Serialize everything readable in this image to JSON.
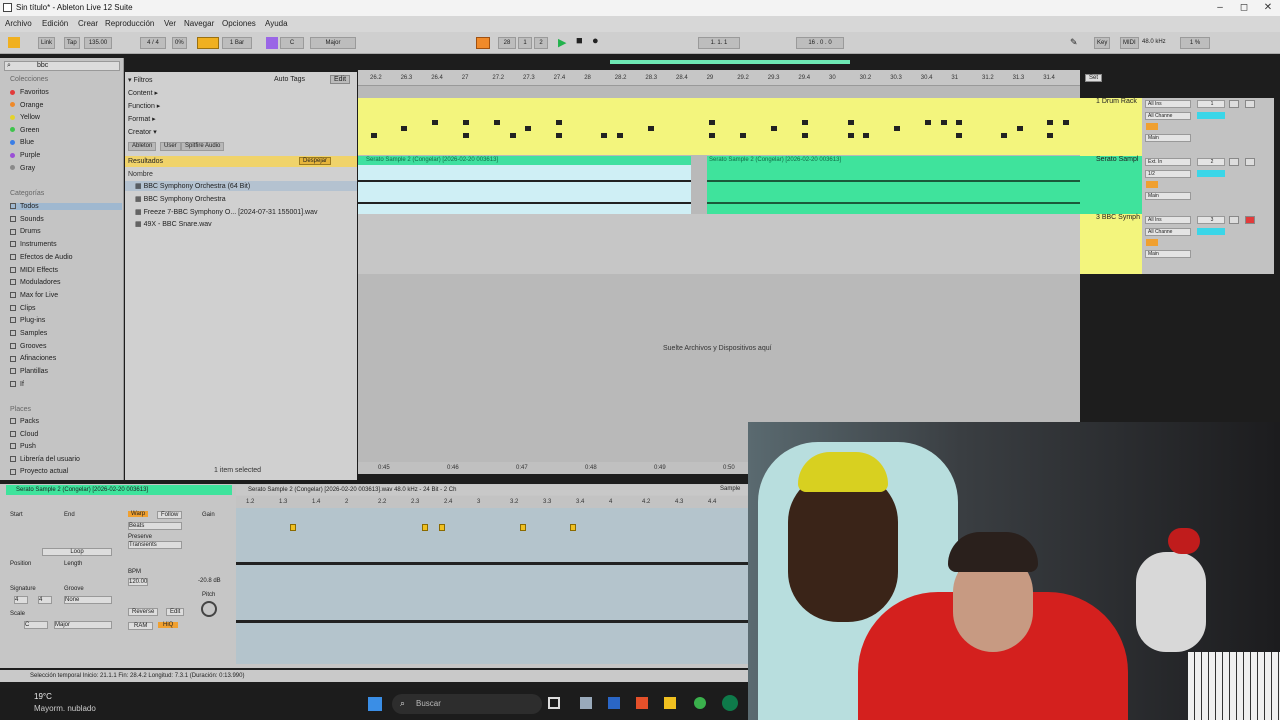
{
  "window": {
    "title": "Sin título* - Ableton Live 12 Suite",
    "minimize": "–",
    "maximize": "◻",
    "close": "✕"
  },
  "menu": [
    "Archivo",
    "Edición",
    "Crear",
    "Reproducción",
    "Ver",
    "Navegar",
    "Opciones",
    "Ayuda"
  ],
  "transport": {
    "link": "Link",
    "tap": "Tap",
    "tempo": "135.00",
    "signature": "4 / 4",
    "pct": "0%",
    "quant": "1 Bar",
    "key": "C",
    "scale": "Major",
    "pos1": "28",
    "pos2": "1",
    "pos3": "2",
    "arr_pos": "1. 1. 1",
    "punch": "16 . 0 . 0",
    "key_btn": "Key",
    "midi": "MIDI",
    "sr": "48.0 kHz",
    "cpu": "1 %"
  },
  "browser": {
    "search": "bbc",
    "collections_title": "Colecciones",
    "collections": [
      {
        "label": "Favoritos",
        "color": "#e23b3b"
      },
      {
        "label": "Orange",
        "color": "#ef8a2a"
      },
      {
        "label": "Yellow",
        "color": "#e4d32c"
      },
      {
        "label": "Green",
        "color": "#3ec44c"
      },
      {
        "label": "Blue",
        "color": "#3a7ee6"
      },
      {
        "label": "Purple",
        "color": "#9a4fd6"
      },
      {
        "label": "Gray",
        "color": "#8a8a8a"
      }
    ],
    "categories_title": "Categorías",
    "categories": [
      "Todos",
      "Sounds",
      "Drums",
      "Instruments",
      "Efectos de Audio",
      "MIDI Effects",
      "Moduladores",
      "Max for Live",
      "Clips",
      "Plug-ins",
      "Samples",
      "Grooves",
      "Afinaciones",
      "Plantillas",
      "If"
    ],
    "places_title": "Places",
    "places": [
      "Packs",
      "Cloud",
      "Push",
      "Librería del usuario",
      "Proyecto actual"
    ],
    "filters": "Filtros",
    "autotags": "Auto Tags",
    "edit": "Edit",
    "filter_items": [
      "Content ▸",
      "Function ▸",
      "Format ▸",
      "Creator ▾"
    ],
    "tags": [
      "Ableton",
      "User",
      "Spitfire Audio"
    ],
    "results": "Resultados",
    "clear": "Despejar",
    "name_col": "Nombre",
    "files": [
      "BBC Symphony Orchestra (64 Bit)",
      "BBC Symphony Orchestra",
      "Freeze 7-BBC Symphony O... [2024-07-31 155001].wav",
      "49X - BBC Snare.wav"
    ],
    "selected": "1 item selected"
  },
  "arrangement": {
    "ruler": [
      "26.2",
      "26.3",
      "26.4",
      "27",
      "27.2",
      "27.3",
      "27.4",
      "28",
      "28.2",
      "28.3",
      "28.4",
      "29",
      "29.2",
      "29.3",
      "29.4",
      "30",
      "30.2",
      "30.3",
      "30.4",
      "31",
      "31.2",
      "31.3",
      "31.4"
    ],
    "clip_a": "Serato Sample 2 (Congelar) [2026-02-20 003613]",
    "clip_b": "Serato Sample 2 (Congelar) [2026-02-20 003613]",
    "drop_hint": "Suelte Archivos y Dispositivos aquí",
    "time_ruler": [
      "0:45",
      "0:46",
      "0:47",
      "0:48",
      "0:49",
      "0:50"
    ],
    "tracks": [
      {
        "name": "1 Drum Rack",
        "num": "1",
        "input": "All Ins",
        "channel": "All Channe",
        "out": "Main"
      },
      {
        "name": "Serato Sampl",
        "num": "2",
        "input": "Ext. In",
        "channel": "1/2",
        "out": "Main"
      },
      {
        "name": "3 BBC Symph",
        "num": "3",
        "input": "All Ins",
        "channel": "All Channe",
        "out": "Main"
      }
    ],
    "set": "Set"
  },
  "detail": {
    "clip": "Serato Sample 2 (Congelar) [2026-02-20 003613]",
    "info": "Serato Sample 2 (Congelar) [2026-02-20 003613].wav 48.0 kHz - 24 Bit - 2 Ch",
    "sample": "Sample",
    "labels": {
      "start": "Start",
      "end": "End",
      "loop": "Loop",
      "position": "Position",
      "length": "Length",
      "signature": "Signature",
      "groove": "Groove",
      "scale": "Scale",
      "warp": "Warp",
      "follow": "Follow",
      "mode": "Beats",
      "preserve": "Preserve",
      "transients": "Transients",
      "bpm": "BPM",
      "bpm_val": "120.00",
      "gain": "Gain",
      "gain_val": "-20.8 dB",
      "pitch": "Pitch",
      "reverse": "Reverse",
      "edit": "Edit",
      "ram": "RAM",
      "hiq": "HiQ",
      "sig_n": "4",
      "sig_d": "4",
      "groove_val": "None",
      "key": "C",
      "mode_s": "Major"
    },
    "ruler": [
      "1.2",
      "1.3",
      "1.4",
      "2",
      "2.2",
      "2.3",
      "2.4",
      "3",
      "3.2",
      "3.3",
      "3.4",
      "4",
      "4.2",
      "4.3",
      "4.4"
    ]
  },
  "status": "Selección temporal    Inicio: 21.1.1    Fin: 28.4.2    Longitud: 7.3.1    (Duración: 0:13.990)",
  "taskbar": {
    "temp": "19°C",
    "weather": "Mayorm. nublado",
    "search": "Buscar"
  },
  "colors": {
    "accent": "#3ee39c",
    "yellow": "#f3f57d",
    "selected": "#f0d36a",
    "orange": "#f39a2a"
  }
}
